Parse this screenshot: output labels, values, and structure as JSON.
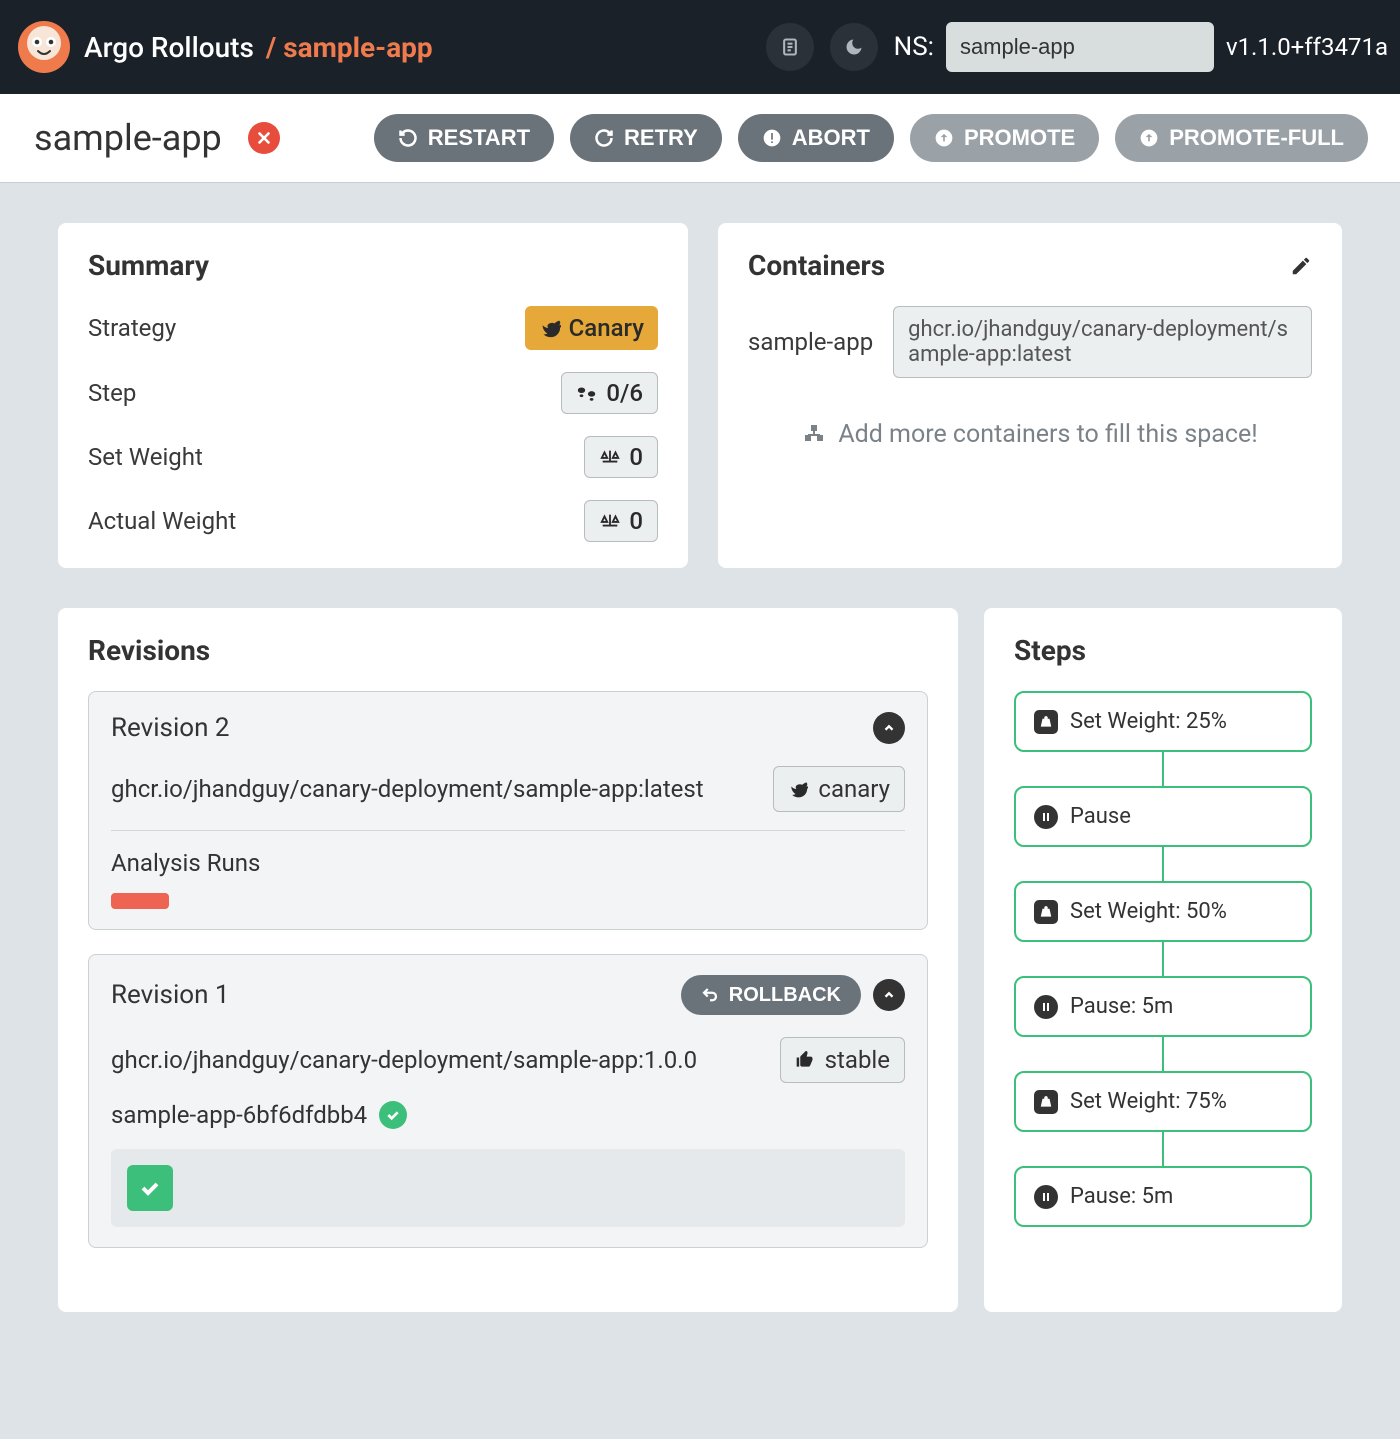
{
  "header": {
    "brand": "Argo Rollouts",
    "breadcrumb_prefix": "/ ",
    "breadcrumb_app": "sample-app",
    "ns_label": "NS:",
    "ns_value": "sample-app",
    "version": "v1.1.0+ff3471a"
  },
  "page": {
    "title": "sample-app"
  },
  "actions": {
    "restart": "RESTART",
    "retry": "RETRY",
    "abort": "ABORT",
    "promote": "PROMOTE",
    "promote_full": "PROMOTE-FULL"
  },
  "summary": {
    "title": "Summary",
    "strategy_label": "Strategy",
    "strategy_value": "Canary",
    "step_label": "Step",
    "step_value": "0/6",
    "set_weight_label": "Set Weight",
    "set_weight_value": "0",
    "actual_weight_label": "Actual Weight",
    "actual_weight_value": "0"
  },
  "containers": {
    "title": "Containers",
    "items": [
      {
        "name": "sample-app",
        "image": "ghcr.io/jhandguy/canary-deployment/sample-app:latest"
      }
    ],
    "add_more": "Add more containers to fill this space!"
  },
  "revisions": {
    "title": "Revisions",
    "items": [
      {
        "title": "Revision 2",
        "image": "ghcr.io/jhandguy/canary-deployment/sample-app:latest",
        "tag": "canary",
        "analysis_label": "Analysis Runs",
        "has_rollback": false
      },
      {
        "title": "Revision 1",
        "image": "ghcr.io/jhandguy/canary-deployment/sample-app:1.0.0",
        "tag": "stable",
        "rollback_label": "ROLLBACK",
        "pod_name": "sample-app-6bf6dfdbb4",
        "has_rollback": true
      }
    ]
  },
  "steps": {
    "title": "Steps",
    "items": [
      {
        "type": "weight",
        "label": "Set Weight: 25%"
      },
      {
        "type": "pause",
        "label": "Pause"
      },
      {
        "type": "weight",
        "label": "Set Weight: 50%"
      },
      {
        "type": "pause",
        "label": "Pause: 5m"
      },
      {
        "type": "weight",
        "label": "Set Weight: 75%"
      },
      {
        "type": "pause",
        "label": "Pause: 5m"
      }
    ]
  }
}
